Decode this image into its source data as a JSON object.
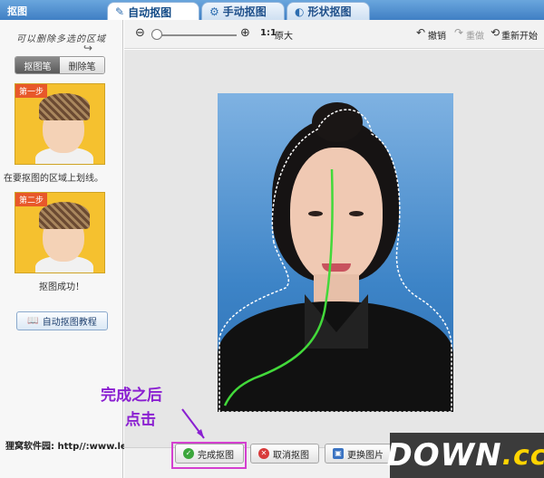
{
  "window": {
    "title": "抠图"
  },
  "tabs": [
    {
      "label": "自动抠图",
      "icon": "brush-icon",
      "active": true
    },
    {
      "label": "手动抠图",
      "icon": "gear-icon",
      "active": false
    },
    {
      "label": "形状抠图",
      "icon": "shapes-icon",
      "active": false
    }
  ],
  "sidebar": {
    "hint": "可以删除多选的区域",
    "modes": [
      "抠图笔",
      "删除笔"
    ],
    "step1": {
      "badge": "第一步",
      "caption": "在要抠图的区域上划线。"
    },
    "step2": {
      "badge": "第二步",
      "caption": "抠图成功！"
    },
    "tutorial_label": "自动抠图教程"
  },
  "toolbar": {
    "zoom_label": "1:1",
    "original_label": "原大",
    "undo": "撤销",
    "redo": "重做",
    "restart": "重新开始"
  },
  "annotation": {
    "line1": "完成之后",
    "line2": "点击"
  },
  "buttons": {
    "done": "完成抠图",
    "cancel": "取消抠图",
    "replace": "更换图片"
  },
  "footer": {
    "site": "狸窝软件园: http//:www.leawo.cn"
  },
  "watermark": {
    "main": "DOWN",
    "suffix": ".cc"
  },
  "colors": {
    "accent": "#3f7fc4",
    "annotation": "#8a1fd1",
    "stroke": "#42d93a"
  }
}
